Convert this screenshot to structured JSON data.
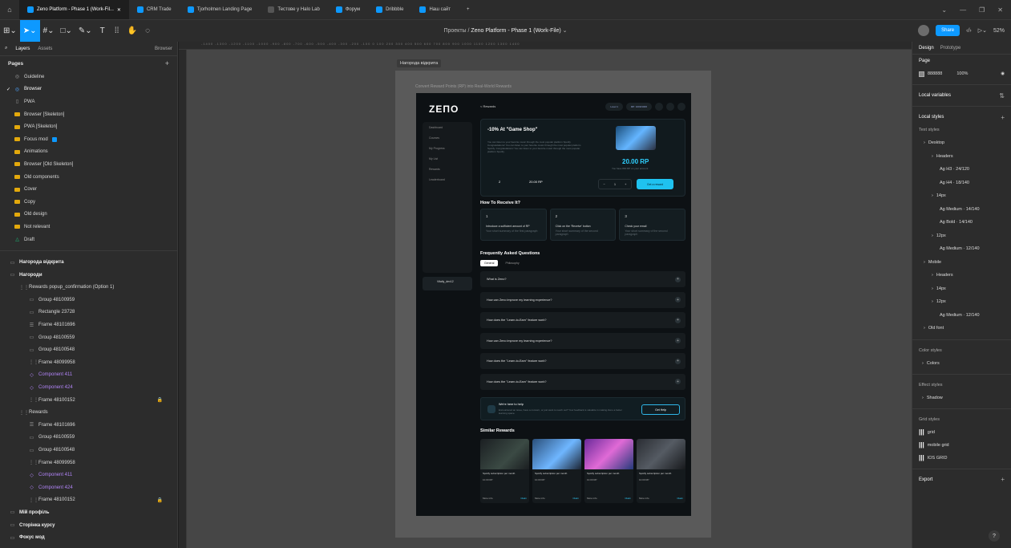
{
  "tabs": [
    {
      "label": "Zeno Platform - Phase 1 (Work-Fil...",
      "active": true
    },
    {
      "label": "CRM Trade",
      "active": false
    },
    {
      "label": "Tjorholmen Landing Page",
      "active": false
    },
    {
      "label": "Тестове у Halo Lab",
      "active": false
    },
    {
      "label": "Форум",
      "active": false
    },
    {
      "label": "Dribbble",
      "active": false
    },
    {
      "label": "Наш сайт",
      "active": false
    }
  ],
  "file": {
    "project": "Проекты",
    "separator": "/",
    "name": "Zeno Platform - Phase 1 (Work-File)"
  },
  "toolbar": {
    "share": "Share",
    "zoom": "52%"
  },
  "left": {
    "tab_layers": "Layers",
    "tab_assets": "Assets",
    "page_dropdown": "Browser",
    "pages_title": "Pages",
    "pages": [
      {
        "label": "Guideline",
        "icon": "◎"
      },
      {
        "label": "Browser",
        "icon": "◎"
      },
      {
        "label": "PWA",
        "icon": "▯"
      },
      {
        "label": "Browser [Skeleton]",
        "icon": "folder"
      },
      {
        "label": "PWA [Skeleton]",
        "icon": "folder"
      },
      {
        "label": "Focus mod",
        "icon": "folder"
      },
      {
        "label": "Animations",
        "icon": "folder"
      },
      {
        "label": "Browser [Old Skeleton]",
        "icon": "folder"
      },
      {
        "label": "Old components",
        "icon": "folder"
      },
      {
        "label": "Cover",
        "icon": "folder"
      },
      {
        "label": "Copy",
        "icon": "folder"
      },
      {
        "label": "Old design",
        "icon": "folder"
      },
      {
        "label": "Not relevant",
        "icon": "folder"
      },
      {
        "label": "Draft",
        "icon": "△"
      }
    ],
    "layers": [
      {
        "label": "Нагорода відкрита",
        "indent": 0,
        "icon": "▭",
        "bold": true
      },
      {
        "label": "Нагороди",
        "indent": 0,
        "icon": "▭",
        "bold": true
      },
      {
        "label": "Rewards popup_confirmation (Option 1)",
        "indent": 1,
        "icon": "⋮⋮"
      },
      {
        "label": "Group 48100959",
        "indent": 2,
        "icon": "▭"
      },
      {
        "label": "Rectangle 23728",
        "indent": 2,
        "icon": "▭"
      },
      {
        "label": "Frame 48101696",
        "indent": 2,
        "icon": "☰"
      },
      {
        "label": "Group 48100559",
        "indent": 2,
        "icon": "▭"
      },
      {
        "label": "Group 48100548",
        "indent": 2,
        "icon": "▭"
      },
      {
        "label": "Frame 48099958",
        "indent": 2,
        "icon": "⋮⋮"
      },
      {
        "label": "Component 411",
        "indent": 2,
        "icon": "◇",
        "purple": true
      },
      {
        "label": "Component 424",
        "indent": 2,
        "icon": "◇",
        "purple": true
      },
      {
        "label": "Frame 48100152",
        "indent": 2,
        "icon": "⋮⋮",
        "lock": true
      },
      {
        "label": "Rewards",
        "indent": 1,
        "icon": "⋮⋮"
      },
      {
        "label": "Frame 48101696",
        "indent": 2,
        "icon": "☰"
      },
      {
        "label": "Group 48100559",
        "indent": 2,
        "icon": "▭"
      },
      {
        "label": "Group 48100548",
        "indent": 2,
        "icon": "▭"
      },
      {
        "label": "Frame 48099958",
        "indent": 2,
        "icon": "⋮⋮"
      },
      {
        "label": "Component 411",
        "indent": 2,
        "icon": "◇",
        "purple": true
      },
      {
        "label": "Component 424",
        "indent": 2,
        "icon": "◇",
        "purple": true
      },
      {
        "label": "Frame 48100152",
        "indent": 2,
        "icon": "⋮⋮",
        "lock": true
      },
      {
        "label": "Мій профіль",
        "indent": 0,
        "icon": "▭",
        "bold": true
      },
      {
        "label": "Сторінка курсу",
        "indent": 0,
        "icon": "▭",
        "bold": true
      },
      {
        "label": "Фокус мод",
        "indent": 0,
        "icon": "▭",
        "bold": true
      }
    ]
  },
  "canvas": {
    "frame_label": "Нагорода відкрита",
    "frame_title": "Convert Reward Points (RP) into Real-World Rewards",
    "app": {
      "logo": "ZEПO",
      "nav": [
        "Dashboard",
        "Courses",
        "My Progress",
        "My List",
        "Rewards",
        "Leaderboard"
      ],
      "user": "Vitaliy_dev12",
      "back": "< Rewards",
      "top_pills": [
        "Level 1",
        "RP: 1000/1000"
      ],
      "hero_title": "-10% At \"Game Shop\"",
      "hero_text": "You can listen to your favorite music through the most popular platform Spotify. Congratulations! You can listen to your favorite music through the most popular platform Spotify. Congratulations! You can listen to your favorite music through the most popular platform Spotify.",
      "rp": "20.00 RP",
      "rp_sub": "You have 800 RP on your account",
      "stat1": "2",
      "stat2": "20.00 RP",
      "stepper_value": "1",
      "get_reward": "Get a reward",
      "how_title": "How To Receive It?",
      "steps": [
        {
          "n": "1",
          "t": "Introduce a sufficient amount of RP",
          "d": "Your short summary of the first paragraph"
        },
        {
          "n": "2",
          "t": "Click on the 'Receive' button",
          "d": "Your short summary of the second paragraph"
        },
        {
          "n": "3",
          "t": "Check your email",
          "d": "Your short summary of the second paragraph"
        }
      ],
      "faq_title": "Frequently Asked Questions",
      "faq_tabs": [
        "General",
        "Philosophy"
      ],
      "faqs": [
        "What is Zeno?",
        "How can Zeno improve my learning experience?",
        "How does the \"Learn-to-Earn\" feature work?",
        "How can Zeno improve my learning experience?",
        "How does the \"Learn-to-Earn\" feature work?",
        "How does the \"Learn-to-Earn\" feature work?"
      ],
      "help_title": "We're here to help",
      "help_text": "Encountered an issue, have a concern, or just want to reach out? Your feedback is valuable in making Zeno a better learning space.",
      "help_btn": "Get Help",
      "similar_title": "Similar Rewards",
      "cards": [
        {
          "t": "Spotify subscription per month",
          "p": "10.00 RP",
          "more": "More info",
          "claim": "Claim"
        },
        {
          "t": "Spotify subscription per month",
          "p": "10.00 RP",
          "more": "More info",
          "claim": "Claim"
        },
        {
          "t": "Spotify subscription per month",
          "p": "10.00 RP",
          "more": "More info",
          "claim": "Claim"
        },
        {
          "t": "Spotify subscription per month",
          "p": "10.00 RP",
          "more": "More info",
          "claim": "Claim"
        }
      ]
    }
  },
  "right": {
    "tab_design": "Design",
    "tab_prototype": "Prototype",
    "page_label": "Page",
    "page_color": "888888",
    "page_opacity": "100%",
    "local_variables": "Local variables",
    "local_styles": "Local styles",
    "text_styles": "Text styles",
    "text_items": [
      {
        "label": "Desktop",
        "level": 1
      },
      {
        "label": "Headers",
        "level": 2
      },
      {
        "label": "Ag H3 · 24/120",
        "level": 3
      },
      {
        "label": "Ag H4 · 18/140",
        "level": 3
      },
      {
        "label": "14px",
        "level": 2
      },
      {
        "label": "Ag Medium · 14/140",
        "level": 3
      },
      {
        "label": "Ag Bold · 14/140",
        "level": 3
      },
      {
        "label": "12px",
        "level": 2
      },
      {
        "label": "Ag Medium · 12/140",
        "level": 3
      },
      {
        "label": "Mobile",
        "level": 1
      },
      {
        "label": "Headers",
        "level": 2
      },
      {
        "label": "14px",
        "level": 2
      },
      {
        "label": "12px",
        "level": 2
      },
      {
        "label": "Ag Medium · 12/140",
        "level": 3
      },
      {
        "label": "Old font",
        "level": 1
      }
    ],
    "color_styles": "Color styles",
    "colors": "Colors",
    "effect_styles": "Effect styles",
    "shadow": "Shadow",
    "grid_styles": "Grid styles",
    "grids": [
      "grid",
      "mobile grid",
      "IOS GRID"
    ],
    "export": "Export"
  }
}
